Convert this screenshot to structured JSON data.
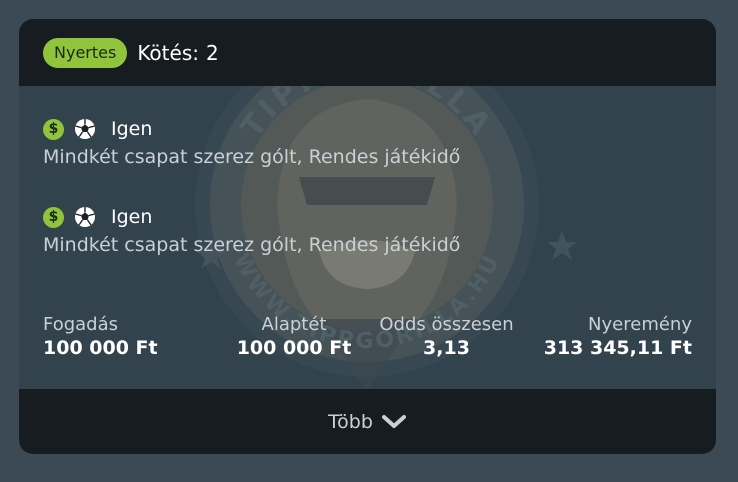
{
  "header": {
    "status_badge": "Nyertes",
    "bet_label": "Kötés:",
    "bet_count": "2"
  },
  "selections": [
    {
      "icons": [
        "dollar-icon",
        "soccer-ball-icon"
      ],
      "pick": "Igen",
      "market": "Mindkét csapat szerez gólt, Rendes játékidő"
    },
    {
      "icons": [
        "dollar-icon",
        "soccer-ball-icon"
      ],
      "pick": "Igen",
      "market": "Mindkét csapat szerez gólt, Rendes játékidő"
    }
  ],
  "stats": [
    {
      "label": "Fogadás",
      "value": "100 000 Ft"
    },
    {
      "label": "Alaptét",
      "value": "100 000 Ft"
    },
    {
      "label": "Odds összesen",
      "value": "3,13"
    },
    {
      "label": "Nyeremény",
      "value": "313 345,11 Ft"
    }
  ],
  "footer": {
    "more_label": "Több",
    "icon": "chevron-down-icon"
  },
  "watermark": {
    "top_text": "TIPPGORILLA",
    "bottom_text": "WWW.TIPPGORILLA.HU"
  },
  "colors": {
    "page_bg": "#3b4a54",
    "card_body": "#33434d",
    "card_header": "#171c20",
    "accent_green": "#8fc43c",
    "text_primary": "#ffffff",
    "text_secondary": "#c9d1d6"
  }
}
